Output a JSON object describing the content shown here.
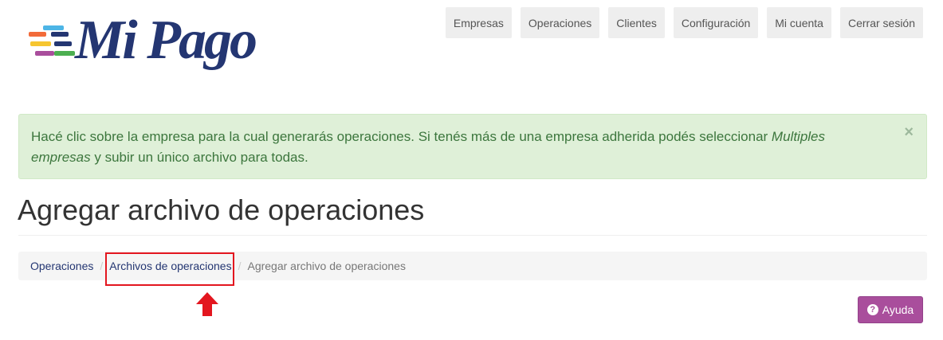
{
  "brand": {
    "name": "Mi Pago",
    "color": "#243672"
  },
  "nav": {
    "items": [
      "Empresas",
      "Operaciones",
      "Clientes",
      "Configuración",
      "Mi cuenta",
      "Cerrar sesión"
    ]
  },
  "alert": {
    "text_before": "Hacé clic sobre la empresa para la cual generarás operaciones. Si tenés más de una empresa adherida podés seleccionar ",
    "emphasis": "Multiples empresas",
    "text_after": " y subir un único archivo para todas.",
    "close_symbol": "×"
  },
  "page": {
    "title": "Agregar archivo de operaciones"
  },
  "breadcrumb": {
    "items": [
      "Operaciones",
      "Archivos de operaciones"
    ],
    "active": "Agregar archivo de operaciones",
    "separator": "/"
  },
  "help_button": {
    "icon": "question-circle-icon",
    "label": "Ayuda",
    "color": "#a94e9c"
  },
  "annotation": {
    "color": "#e3161f"
  }
}
